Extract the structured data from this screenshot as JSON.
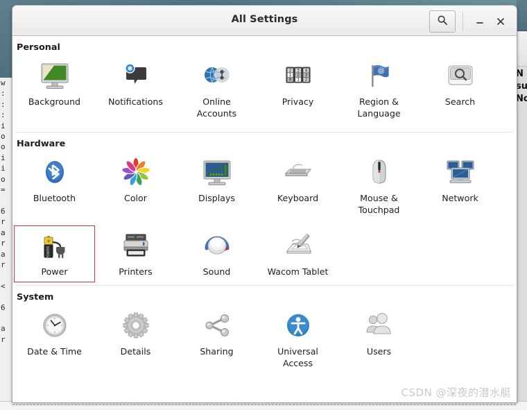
{
  "window": {
    "title": "All Settings",
    "buttons": {
      "search": "search-icon",
      "minimize": "–",
      "close": "×"
    }
  },
  "background": {
    "left_text": "w\n:\n:\n:\ni\no\no\ni\ni\no\n=\n\n6\nr\na\nr\na\nr\n\n<\n\n6\n\na\nr",
    "right_text": "N\nsu\nNo"
  },
  "watermark": "CSDN @深夜的潜水艇",
  "sections": [
    {
      "heading": "Personal",
      "items": [
        {
          "label": "Background",
          "icon": "monitor-wallpaper-icon",
          "selected": false
        },
        {
          "label": "Notifications",
          "icon": "notification-bubble-icon",
          "selected": false
        },
        {
          "label": "Online Accounts",
          "icon": "globe-accounts-icon",
          "selected": false
        },
        {
          "label": "Privacy",
          "icon": "combination-lock-icon",
          "selected": false
        },
        {
          "label": "Region & Language",
          "icon": "flag-icon",
          "selected": false
        },
        {
          "label": "Search",
          "icon": "magnifier-panel-icon",
          "selected": false
        }
      ]
    },
    {
      "heading": "Hardware",
      "items": [
        {
          "label": "Bluetooth",
          "icon": "bluetooth-icon",
          "selected": false
        },
        {
          "label": "Color",
          "icon": "color-flower-icon",
          "selected": false
        },
        {
          "label": "Displays",
          "icon": "display-ruler-icon",
          "selected": false
        },
        {
          "label": "Keyboard",
          "icon": "keyboard-icon",
          "selected": false
        },
        {
          "label": "Mouse & Touchpad",
          "icon": "mouse-icon",
          "selected": false
        },
        {
          "label": "Network",
          "icon": "network-computers-icon",
          "selected": false
        },
        {
          "label": "Power",
          "icon": "battery-plug-icon",
          "selected": true
        },
        {
          "label": "Printers",
          "icon": "printer-icon",
          "selected": false
        },
        {
          "label": "Sound",
          "icon": "speaker-knob-icon",
          "selected": false
        },
        {
          "label": "Wacom Tablet",
          "icon": "tablet-stylus-icon",
          "selected": false
        }
      ]
    },
    {
      "heading": "System",
      "items": [
        {
          "label": "Date & Time",
          "icon": "clock-icon",
          "selected": false
        },
        {
          "label": "Details",
          "icon": "gear-icon",
          "selected": false
        },
        {
          "label": "Sharing",
          "icon": "share-nodes-icon",
          "selected": false
        },
        {
          "label": "Universal Access",
          "icon": "accessibility-icon",
          "selected": false
        },
        {
          "label": "Users",
          "icon": "users-icon",
          "selected": false
        }
      ]
    }
  ],
  "colors": {
    "selection_border": "#e03030",
    "titlebar": "#f1f1f1",
    "desktop_teal": "#5d7f8c",
    "accent_blue": "#2a6fb5"
  }
}
